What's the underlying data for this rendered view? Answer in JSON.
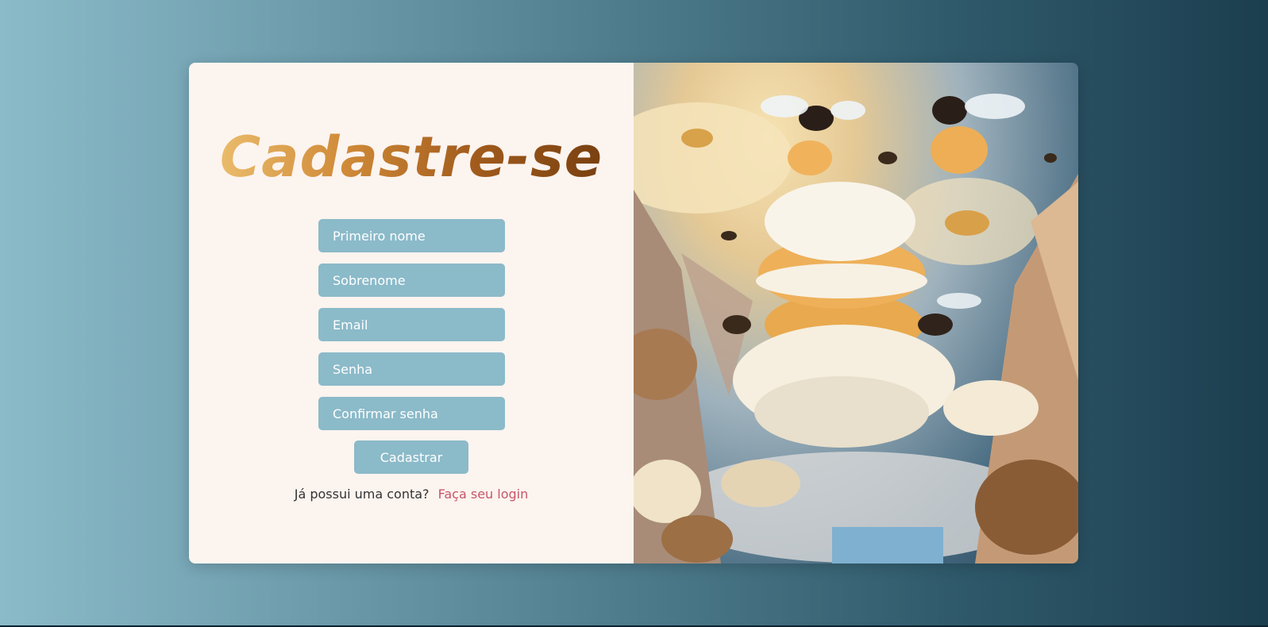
{
  "form": {
    "title": "Cadastre-se",
    "fields": [
      {
        "placeholder": "Primeiro nome"
      },
      {
        "placeholder": "Sobrenome"
      },
      {
        "placeholder": "Email"
      },
      {
        "placeholder": "Senha"
      },
      {
        "placeholder": "Confirmar senha"
      }
    ],
    "submit_label": "Cadastrar",
    "login_prompt": "Já possui uma conta?",
    "login_link": "Faça seu login"
  },
  "colors": {
    "accent": "#8bbac9",
    "panel_bg": "#fcf4ef",
    "link": "#c7566a"
  },
  "image": {
    "subject": "bees-and-cream-puff-illustration"
  }
}
